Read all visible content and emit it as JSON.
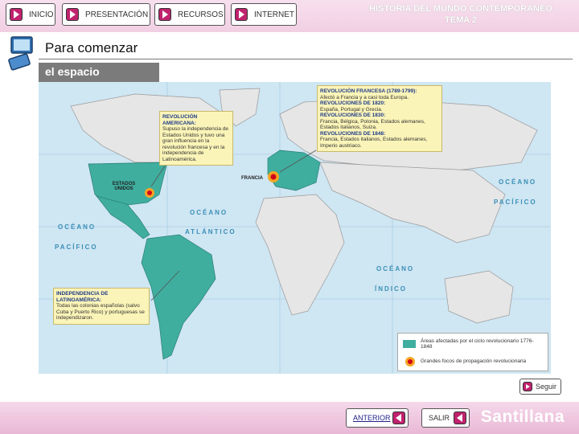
{
  "nav": {
    "inicio": "INICIO",
    "presentacion": "PRESENTACIÓN",
    "recursos": "RECURSOS",
    "internet": "INTERNET"
  },
  "header": {
    "title_line1": "HISTORIA DEL MUNDO CONTEMPORÁNEO",
    "title_line2": "TEMA 2"
  },
  "section": {
    "title": "Para comenzar"
  },
  "map": {
    "tab": "el espacio",
    "oceans": {
      "atlantico_1": "OCÉANO",
      "atlantico_2": "ATLÁNTICO",
      "pacifico_w1": "OCÉANO",
      "pacifico_w2": "PACÍFICO",
      "pacifico_e1": "OCÉANO",
      "pacifico_e2": "PACÍFICO",
      "indico_1": "OCÉANO",
      "indico_2": "ÍNDICO"
    },
    "labels": {
      "eeuu": "ESTADOS UNIDOS",
      "francia": "FRANCIA"
    },
    "callout_america": {
      "title": "REVOLUCIÓN AMERICANA:",
      "text": "Supuso la independencia de Estados Unidos y tuvo una gran influencia en la revolución francesa y en la independencia de Latinoamérica."
    },
    "callout_europe": [
      {
        "title": "REVOLUCIÓN FRANCESA (1789-1799):",
        "text": "Afectó a Francia y a casi toda Europa."
      },
      {
        "title": "REVOLUCIONES DE 1820:",
        "text": "España, Portugal y Grecia."
      },
      {
        "title": "REVOLUCIONES DE 1830:",
        "text": "Francia, Bélgica, Polonia, Estados alemanes, Estados italianos, Suiza."
      },
      {
        "title": "REVOLUCIONES DE 1848:",
        "text": "Francia, Estados italianos, Estados alemanes, Imperio austriaco."
      }
    ],
    "callout_latam": {
      "title": "INDEPENDENCIA DE LATINOAMÉRICA:",
      "text": "Todas las colonias españolas (salvo Cuba y Puerto Rico) y portuguesas se independizaron."
    },
    "legend": {
      "item1": "Áreas afectadas por el ciclo revolucionario 1776-1848",
      "item2": "Grandes focos de propagación revolucionaria"
    },
    "colors": {
      "affected": "#3fae9f",
      "land": "#e6e6e6",
      "sea": "#cfe6f3"
    }
  },
  "buttons": {
    "seguir": "Seguir",
    "anterior": "ANTERIOR",
    "salir": "SALIR"
  },
  "brand": "Santillana"
}
